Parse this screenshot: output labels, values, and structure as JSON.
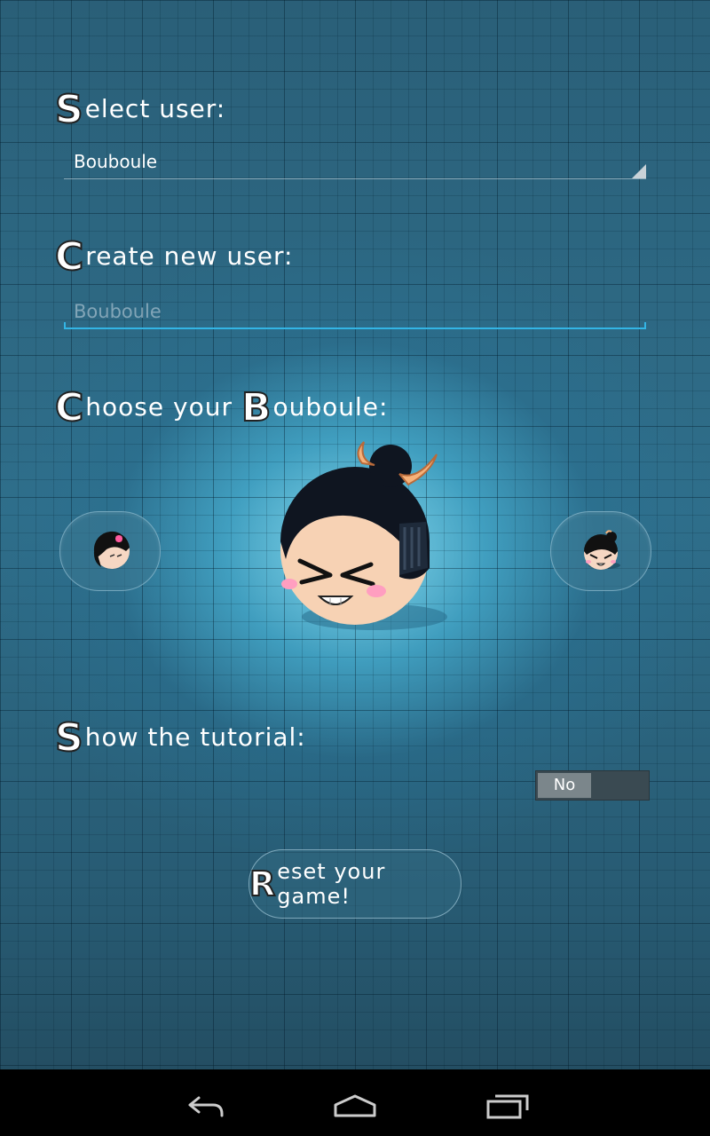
{
  "select_user": {
    "heading_cap": "S",
    "heading_rest": "elect user:",
    "selected_value": "Bouboule"
  },
  "create_user": {
    "heading_cap": "C",
    "heading_rest": "reate new user:",
    "placeholder": "Bouboule"
  },
  "choose": {
    "heading_cap1": "C",
    "heading_mid": "hoose your ",
    "heading_cap2": "B",
    "heading_rest": "ouboule:"
  },
  "tutorial": {
    "heading_cap": "S",
    "heading_rest": "how the tutorial:",
    "toggle_value": "No"
  },
  "reset": {
    "cap": "R",
    "rest": "eset your game!"
  },
  "navbar": {
    "icons": [
      "back-icon",
      "home-icon",
      "recent-apps-icon"
    ]
  },
  "colors": {
    "accent": "#33b5e5",
    "bg_dark": "#22495c",
    "bg_glow": "#8ce1f5"
  }
}
